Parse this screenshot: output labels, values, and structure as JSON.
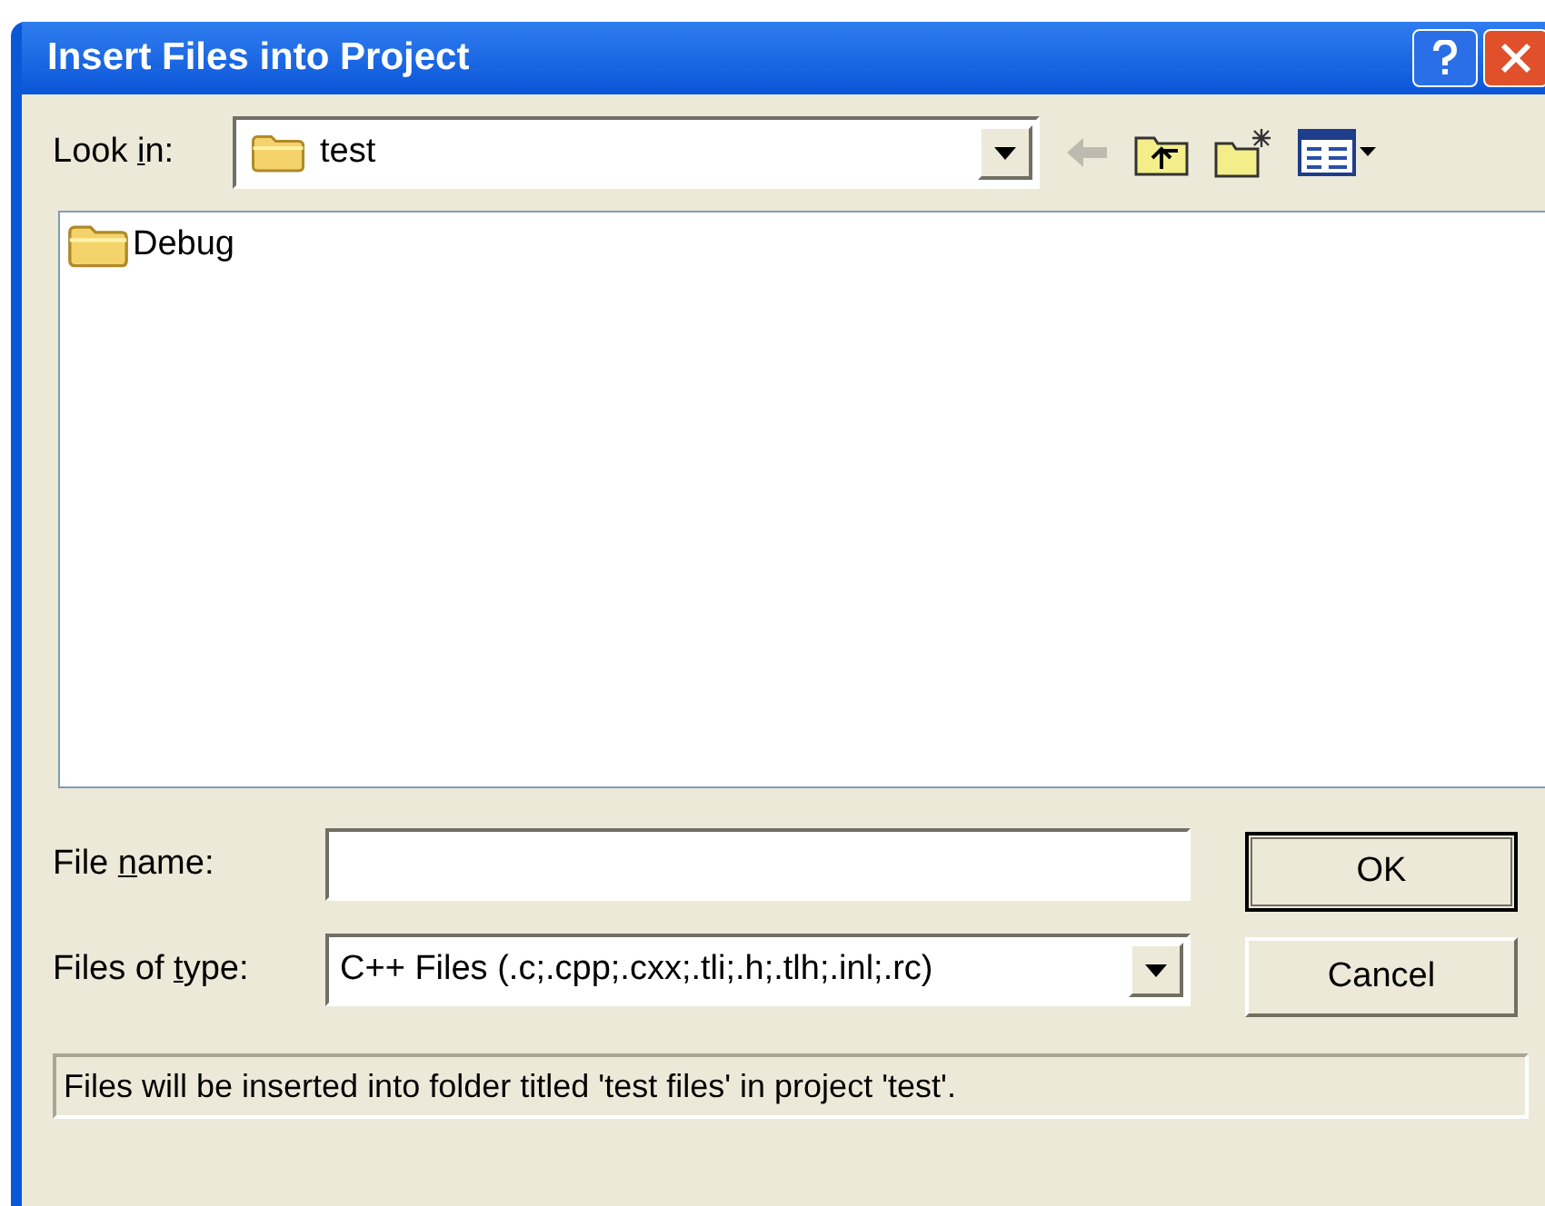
{
  "window": {
    "title": "Insert Files into Project"
  },
  "look_in": {
    "label": {
      "before": "Look ",
      "key": "i",
      "after": "n:"
    },
    "value": "test"
  },
  "files": [
    {
      "name": "Debug",
      "kind": "folder"
    }
  ],
  "file_name": {
    "label": {
      "before": "File ",
      "key": "n",
      "after": "ame:"
    }
  },
  "file_type": {
    "label": {
      "before": "Files of ",
      "key": "t",
      "after": "ype:"
    },
    "value": "C++ Files (.c;.cpp;.cxx;.tli;.h;.tlh;.inl;.rc)"
  },
  "buttons": [
    {
      "label": "OK",
      "default": true
    },
    {
      "label": "Cancel",
      "default": false
    }
  ],
  "status": "Files will be inserted into folder titled 'test files' in project 'test'."
}
